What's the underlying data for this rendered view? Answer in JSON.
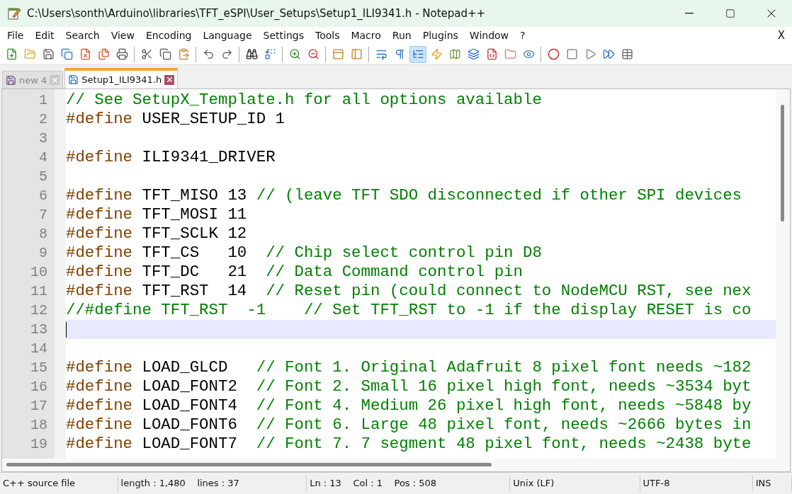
{
  "window": {
    "title": "C:\\Users\\sonth\\Arduino\\libraries\\TFT_eSPI\\User_Setups\\Setup1_ILI9341.h - Notepad++"
  },
  "menu": [
    "File",
    "Edit",
    "Search",
    "View",
    "Encoding",
    "Language",
    "Settings",
    "Tools",
    "Macro",
    "Run",
    "Plugins",
    "Window",
    "?"
  ],
  "menu_close": "X",
  "toolbar_buttons": [
    {
      "pressed": false
    },
    {
      "pressed": false
    },
    {
      "pressed": false
    },
    {
      "pressed": false
    },
    {
      "pressed": false
    },
    {
      "pressed": false
    },
    {
      "pressed": false
    },
    {
      "pressed": false
    },
    {
      "pressed": false
    },
    {
      "pressed": false
    },
    {
      "pressed": false
    },
    {
      "pressed": false
    },
    {
      "pressed": false
    },
    {
      "pressed": false
    },
    {
      "pressed": false
    },
    {
      "pressed": false
    },
    {
      "pressed": false
    },
    {
      "pressed": false
    },
    {
      "pressed": false
    },
    {
      "pressed": false
    },
    {
      "pressed": true
    },
    {
      "pressed": false
    },
    {
      "pressed": false
    },
    {
      "pressed": false
    },
    {
      "pressed": false
    },
    {
      "pressed": false
    },
    {
      "pressed": false
    },
    {
      "pressed": false
    },
    {
      "pressed": false
    },
    {
      "pressed": false
    },
    {
      "pressed": false
    },
    {
      "pressed": false
    }
  ],
  "tabs": [
    {
      "label": "new 4",
      "selected": false
    },
    {
      "label": "Setup1_ILI9341.h",
      "selected": true
    }
  ],
  "lines": [
    {
      "number": "1",
      "current": false,
      "code": [
        {
          "kind": "comment",
          "text": "// See SetupX_Template.h for all options available"
        }
      ]
    },
    {
      "number": "2",
      "current": false,
      "code": [
        {
          "kind": "preproc",
          "text": "#define"
        },
        {
          "kind": "plain",
          "text": " USER_SETUP_ID 1"
        }
      ]
    },
    {
      "number": "3",
      "current": false
    },
    {
      "number": "4",
      "current": false,
      "code": [
        {
          "kind": "preproc",
          "text": "#define"
        },
        {
          "kind": "plain",
          "text": " ILI9341_DRIVER"
        }
      ]
    },
    {
      "number": "5",
      "current": false
    },
    {
      "number": "6",
      "current": false,
      "code": [
        {
          "kind": "preproc",
          "text": "#define"
        },
        {
          "kind": "plain",
          "text": " TFT_MISO 13 "
        },
        {
          "kind": "comment",
          "text": "// (leave TFT SDO disconnected if other SPI devices"
        }
      ]
    },
    {
      "number": "7",
      "current": false,
      "code": [
        {
          "kind": "preproc",
          "text": "#define"
        },
        {
          "kind": "plain",
          "text": " TFT_MOSI 11"
        }
      ]
    },
    {
      "number": "8",
      "current": false,
      "code": [
        {
          "kind": "preproc",
          "text": "#define"
        },
        {
          "kind": "plain",
          "text": " TFT_SCLK 12"
        }
      ]
    },
    {
      "number": "9",
      "current": false,
      "code": [
        {
          "kind": "preproc",
          "text": "#define"
        },
        {
          "kind": "plain",
          "text": " TFT_CS   10  "
        },
        {
          "kind": "comment",
          "text": "// Chip select control pin D8"
        }
      ]
    },
    {
      "number": "10",
      "current": false,
      "code": [
        {
          "kind": "preproc",
          "text": "#define"
        },
        {
          "kind": "plain",
          "text": " TFT_DC   21  "
        },
        {
          "kind": "comment",
          "text": "// Data Command control pin"
        }
      ]
    },
    {
      "number": "11",
      "current": false,
      "code": [
        {
          "kind": "preproc",
          "text": "#define"
        },
        {
          "kind": "plain",
          "text": " TFT_RST  14  "
        },
        {
          "kind": "comment",
          "text": "// Reset pin (could connect to NodeMCU RST, see nex"
        }
      ]
    },
    {
      "number": "12",
      "current": false,
      "code": [
        {
          "kind": "comment",
          "text": "//#define TFT_RST  -1    // Set TFT_RST to -1 if the display RESET is co"
        }
      ]
    },
    {
      "number": "13",
      "current": true
    },
    {
      "number": "14",
      "current": false
    },
    {
      "number": "15",
      "current": false,
      "code": [
        {
          "kind": "preproc",
          "text": "#define"
        },
        {
          "kind": "plain",
          "text": " LOAD_GLCD   "
        },
        {
          "kind": "comment",
          "text": "// Font 1. Original Adafruit 8 pixel font needs ~182"
        }
      ]
    },
    {
      "number": "16",
      "current": false,
      "code": [
        {
          "kind": "preproc",
          "text": "#define"
        },
        {
          "kind": "plain",
          "text": " LOAD_FONT2  "
        },
        {
          "kind": "comment",
          "text": "// Font 2. Small 16 pixel high font, needs ~3534 byt"
        }
      ]
    },
    {
      "number": "17",
      "current": false,
      "code": [
        {
          "kind": "preproc",
          "text": "#define"
        },
        {
          "kind": "plain",
          "text": " LOAD_FONT4  "
        },
        {
          "kind": "comment",
          "text": "// Font 4. Medium 26 pixel high font, needs ~5848 by"
        }
      ]
    },
    {
      "number": "18",
      "current": false,
      "code": [
        {
          "kind": "preproc",
          "text": "#define"
        },
        {
          "kind": "plain",
          "text": " LOAD_FONT6  "
        },
        {
          "kind": "comment",
          "text": "// Font 6. Large 48 pixel font, needs ~2666 bytes in"
        }
      ]
    },
    {
      "number": "19",
      "current": false,
      "code": [
        {
          "kind": "preproc",
          "text": "#define"
        },
        {
          "kind": "plain",
          "text": " LOAD_FONT7  "
        },
        {
          "kind": "comment",
          "text": "// Font 7. 7 segment 48 pixel font, needs ~2438 byte"
        }
      ]
    }
  ],
  "status_bar": [
    {
      "text": "C++ source file"
    },
    {
      "text": "length : 1,480    lines : 37"
    },
    {
      "text": "Ln : 13    Col : 1    Pos : 508"
    },
    {
      "text": "Unix (LF)"
    },
    {
      "text": "UTF-8"
    },
    {
      "text": "INS"
    }
  ]
}
